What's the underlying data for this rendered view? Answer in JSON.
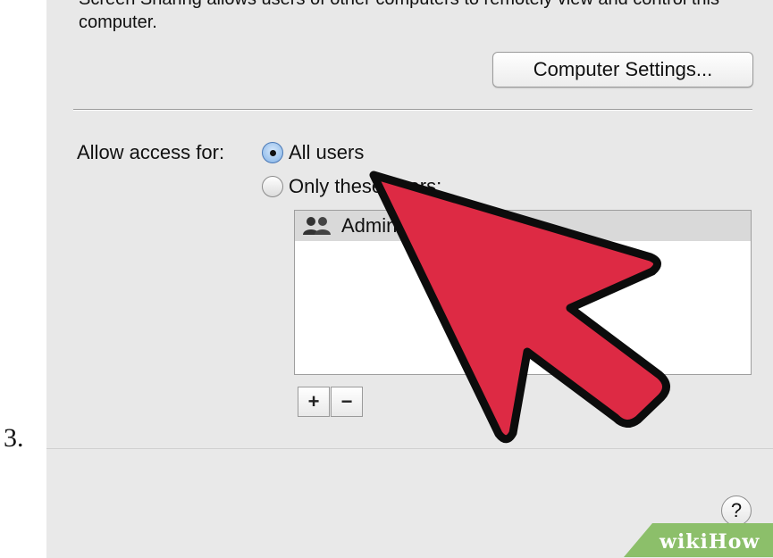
{
  "step": {
    "number": "3."
  },
  "screen_sharing": {
    "description": "Screen Sharing allows users of other computers to remotely view and control this computer.",
    "computer_settings_button": "Computer Settings..."
  },
  "access": {
    "label": "Allow access for:",
    "options": [
      {
        "label": "All users",
        "selected": true
      },
      {
        "label": "Only these users:",
        "selected": false
      }
    ],
    "users_list": [
      {
        "label": "Administrators",
        "icon": "group-icon"
      }
    ],
    "add_button": "+",
    "remove_button": "−"
  },
  "help": {
    "label": "?"
  },
  "watermark": {
    "part1": "wiki",
    "part2": "How"
  },
  "colors": {
    "arrow": "#dd2a44",
    "watermark_bg": "#8cbf6a"
  }
}
